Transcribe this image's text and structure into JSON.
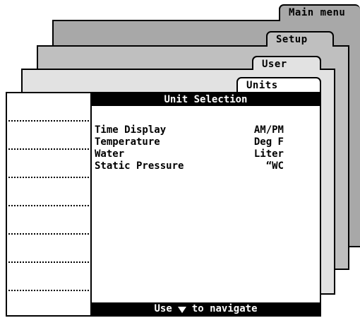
{
  "tabs": {
    "main_menu": "Main menu",
    "setup": "Setup",
    "user": "User",
    "units": "Units"
  },
  "screen": {
    "title": "Unit Selection",
    "rows": [
      {
        "label": "Time Display",
        "value": "AM/PM"
      },
      {
        "label": "Temperature",
        "value": "Deg F"
      },
      {
        "label": "Water",
        "value": "Liter"
      },
      {
        "label": "Static Pressure",
        "value": "“WC"
      }
    ],
    "footer_prefix": "Use",
    "footer_suffix": "to navigate",
    "footer_icon": "down-triangle-icon"
  },
  "colors": {
    "main_layer": "#a8a8a8",
    "setup_layer": "#bfbfbf",
    "user_layer": "#e2e2e2",
    "units_layer": "#ffffff"
  }
}
